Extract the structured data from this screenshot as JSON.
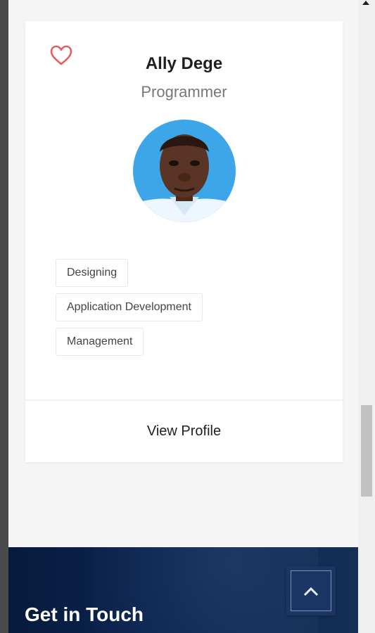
{
  "profile_card": {
    "name": "Ally Dege",
    "role": "Programmer",
    "skills": [
      "Designing",
      "Application Development",
      "Management"
    ],
    "view_profile_label": "View Profile"
  },
  "footer": {
    "title": "Get in Touch"
  },
  "icons": {
    "favorite": "heart-outline-icon",
    "back_to_top": "chevron-up-icon",
    "scroll_up": "triangle-up-icon"
  },
  "colors": {
    "heart": "#e85b5b",
    "avatar_background": "#3da6e8",
    "footer_dark": "#071a3c",
    "footer_accent": "#1b3665"
  }
}
